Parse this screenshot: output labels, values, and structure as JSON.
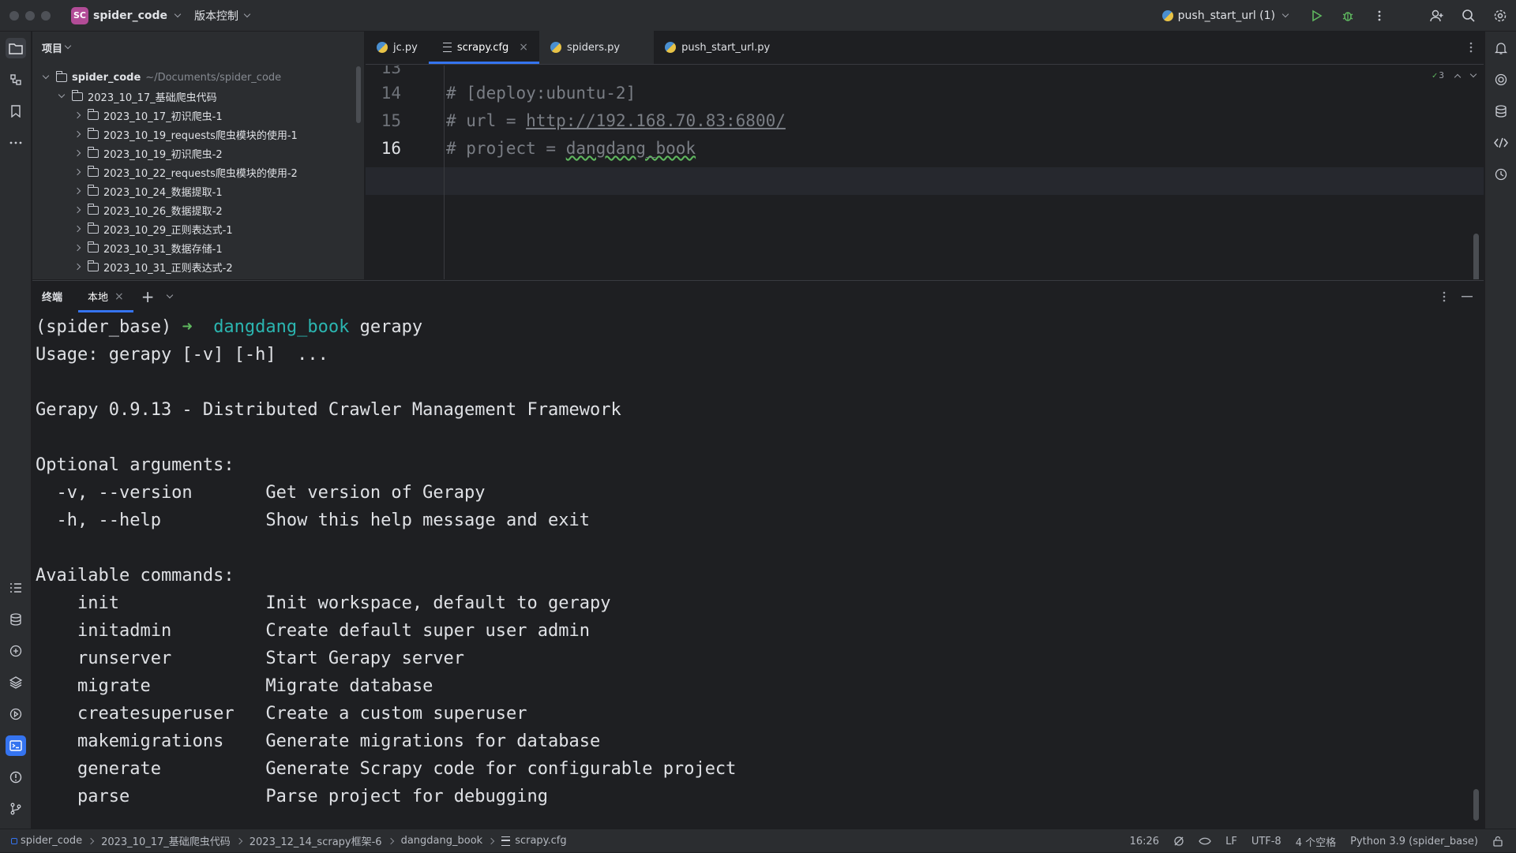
{
  "titlebar": {
    "project_badge": "SC",
    "project_name": "spider_code",
    "vcs_label": "版本控制",
    "run_config": "push_start_url (1)"
  },
  "project_panel": {
    "title": "项目",
    "root": {
      "name": "spider_code",
      "path": "~/Documents/spider_code"
    },
    "folder": "2023_10_17_基础爬虫代码",
    "children": [
      "2023_10_17_初识爬虫-1",
      "2023_10_19_requests爬虫模块的使用-1",
      "2023_10_19_初识爬虫-2",
      "2023_10_22_requests爬虫模块的使用-2",
      "2023_10_24_数据提取-1",
      "2023_10_26_数据提取-2",
      "2023_10_29_正则表达式-1",
      "2023_10_31_数据存储-1",
      "2023_10_31_正则表达式-2"
    ]
  },
  "editor": {
    "tabs": [
      "jc.py",
      "scrapy.cfg",
      "spiders.py",
      "push_start_url.py"
    ],
    "active_tab": "scrapy.cfg",
    "inspection_count": "3",
    "lines": [
      {
        "num": "13",
        "text": ""
      },
      {
        "num": "14",
        "text": "# [deploy:ubuntu-2]"
      },
      {
        "num": "15",
        "prefix": "# url = ",
        "link": "http://192.168.70.83:6800/"
      },
      {
        "num": "16",
        "prefix": "# project = ",
        "squig": "dangdang_book"
      }
    ]
  },
  "terminal": {
    "title": "终端",
    "tab": "本地",
    "prompt_env": "(spider_base)",
    "prompt_arrow": "➜",
    "prompt_dir": "dangdang_book",
    "prompt_cmd": "gerapy",
    "output": [
      "Usage: gerapy [-v] [-h]  ...",
      "",
      "Gerapy 0.9.13 - Distributed Crawler Management Framework",
      "",
      "Optional arguments:",
      "  -v, --version       Get version of Gerapy",
      "  -h, --help          Show this help message and exit",
      "",
      "Available commands:",
      "    init              Init workspace, default to gerapy",
      "    initadmin         Create default super user admin",
      "    runserver         Start Gerapy server",
      "    migrate           Migrate database",
      "    createsuperuser   Create a custom superuser",
      "    makemigrations    Generate migrations for database",
      "    generate          Generate Scrapy code for configurable project",
      "    parse             Parse project for debugging"
    ]
  },
  "statusbar": {
    "breadcrumbs": [
      "spider_code",
      "2023_10_17_基础爬虫代码",
      "2023_12_14_scrapy框架-6",
      "dangdang_book",
      "scrapy.cfg"
    ],
    "position": "16:26",
    "line_ending": "LF",
    "encoding": "UTF-8",
    "indent": "4 个空格",
    "interpreter": "Python 3.9 (spider_base)"
  },
  "colors": {
    "accent": "#3574f0",
    "badge": "#b24c97",
    "run": "#5fb85f"
  }
}
